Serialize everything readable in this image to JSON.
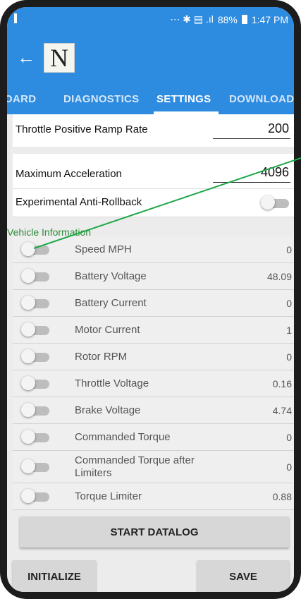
{
  "statusbar": {
    "icons": "⋯ ✱ ▤ .ıl",
    "battery": "88%",
    "time": "1:47 PM"
  },
  "appbar": {
    "back_icon": "←",
    "logo_text": "N"
  },
  "tabs": [
    {
      "label": "OARD",
      "active": false
    },
    {
      "label": "DIAGNOSTICS",
      "active": false
    },
    {
      "label": "SETTINGS",
      "active": true
    },
    {
      "label": "DOWNLOAD",
      "active": false
    }
  ],
  "settings": {
    "throttle_ramp": {
      "label": "Throttle Positive Ramp Rate",
      "value": "200"
    },
    "max_accel": {
      "label": "Maximum Acceleration",
      "value": "4096"
    },
    "anti_rollback": {
      "label": "Experimental Anti-Rollback",
      "on": false
    }
  },
  "vehicle_info": {
    "title": "Vehicle Information",
    "items": [
      {
        "label": "Speed MPH",
        "value": "0"
      },
      {
        "label": "Battery Voltage",
        "value": "48.09"
      },
      {
        "label": "Battery Current",
        "value": "0"
      },
      {
        "label": "Motor Current",
        "value": "1"
      },
      {
        "label": "Rotor RPM",
        "value": "0"
      },
      {
        "label": "Throttle Voltage",
        "value": "0.16"
      },
      {
        "label": "Brake Voltage",
        "value": "4.74"
      },
      {
        "label": "Commanded Torque",
        "value": "0"
      },
      {
        "label": "Commanded Torque after Limiters",
        "value": "0"
      },
      {
        "label": "Torque Limiter",
        "value": "0.88"
      }
    ]
  },
  "buttons": {
    "start_datalog": "START DATALOG",
    "initialize": "INITIALIZE",
    "save": "SAVE"
  },
  "colors": {
    "app_blue": "#2d8be0",
    "section_green": "#2e8b3a",
    "annotation_line": "#1fa84a"
  }
}
